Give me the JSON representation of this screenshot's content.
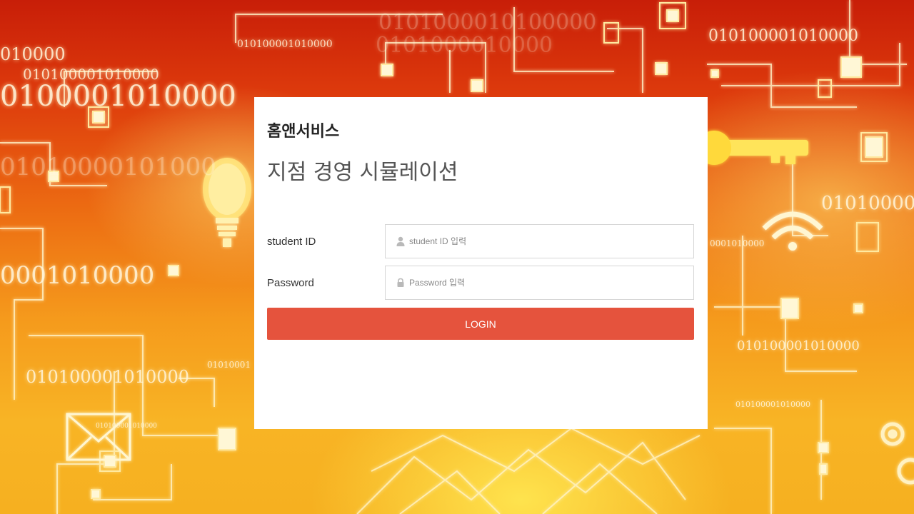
{
  "colors": {
    "accent": "#e5533d",
    "card_background": "#ffffff",
    "brand_text": "#222222",
    "title_text": "#555555",
    "field_border": "#d6d6d6"
  },
  "background": {
    "description_icons": [
      "lightbulb-icon",
      "key-icon",
      "wifi-icon",
      "envelope-icon",
      "gear-icon"
    ],
    "binary_strings": [
      "010000",
      "010100001010000",
      "0100001010000",
      "01010000101000",
      "01001010000",
      "0001010000",
      "010100001010000",
      "0101000010100000",
      "0101000010000",
      "010100001010000",
      "010100001010000",
      "01010001",
      "0001010000",
      "010100001010000",
      "010100001010000"
    ]
  },
  "login": {
    "brand": "홈앤서비스",
    "title": "지점 경영 시뮬레이션",
    "student_id_label": "student ID",
    "student_id_placeholder": "student ID 입력",
    "student_id_icon": "user-icon",
    "password_label": "Password",
    "password_placeholder": "Password 입력",
    "password_icon": "lock-icon",
    "login_button": "LOGIN"
  }
}
